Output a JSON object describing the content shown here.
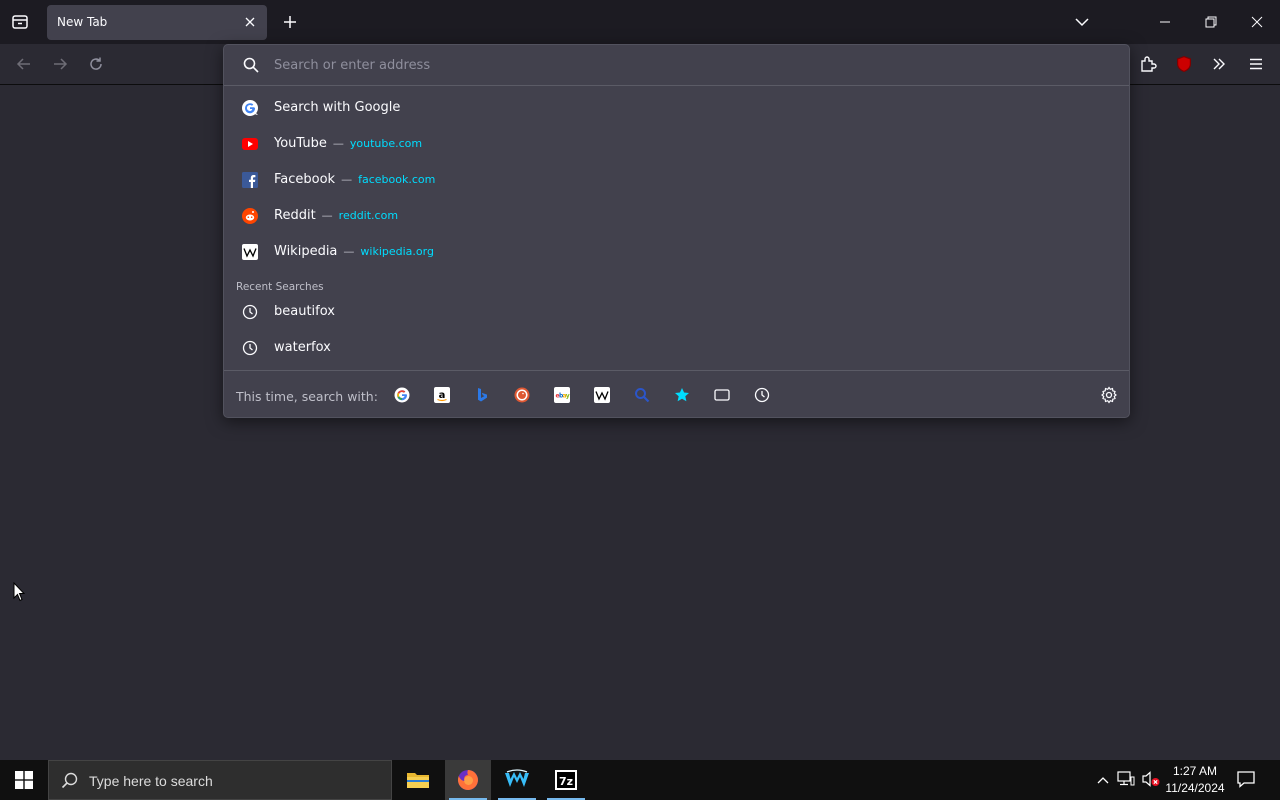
{
  "tabstrip": {
    "tab_title": "New Tab"
  },
  "urlbar": {
    "placeholder": "Search or enter address",
    "results": [
      {
        "title": "Search with Google",
        "url": "",
        "icon": "google-icon"
      },
      {
        "title": "YouTube",
        "url": "youtube.com",
        "icon": "youtube-icon"
      },
      {
        "title": "Facebook",
        "url": "facebook.com",
        "icon": "facebook-icon"
      },
      {
        "title": "Reddit",
        "url": "reddit.com",
        "icon": "reddit-icon"
      },
      {
        "title": "Wikipedia",
        "url": "wikipedia.org",
        "icon": "wikipedia-icon"
      }
    ],
    "separator": "—",
    "recent_header": "Recent Searches",
    "recent": [
      {
        "title": "beautifox",
        "icon": "clock-icon"
      },
      {
        "title": "waterfox",
        "icon": "clock-icon"
      }
    ],
    "oneoff_label": "This time, search with:",
    "oneoff_engines": [
      "google-icon",
      "amazon-icon",
      "bing-icon",
      "duckduckgo-icon",
      "ebay-icon",
      "wikipedia-icon",
      "search-mode-icon",
      "bookmarks-star-icon",
      "tabs-icon",
      "history-icon"
    ]
  },
  "taskbar": {
    "search_placeholder": "Type here to search",
    "time": "1:27 AM",
    "date": "11/24/2024"
  },
  "colors": {
    "accent_url": "#00ddff",
    "popup_bg": "#42414d",
    "content_bg": "#2b2a33"
  }
}
